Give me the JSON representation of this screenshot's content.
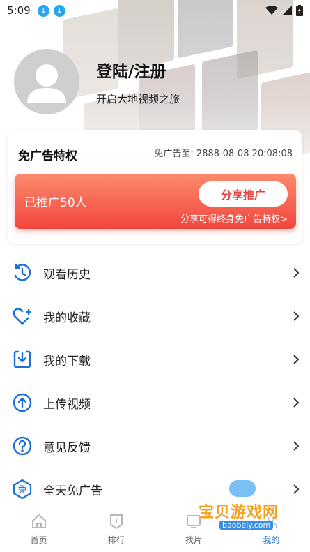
{
  "status_bar": {
    "time": "5:09"
  },
  "profile": {
    "title": "登陆/注册",
    "subtitle": "开启大地视频之旅"
  },
  "vip": {
    "title": "免广告特权",
    "expire_label": "免广告至:",
    "expire_value": "2888-08-08 20:08:08",
    "promo_count": "已推广50人",
    "share_button": "分享推广",
    "promo_note": "分享可得终身免广告特权>"
  },
  "menu": [
    {
      "label": "观看历史",
      "icon": "history-icon"
    },
    {
      "label": "我的收藏",
      "icon": "heart-plus-icon"
    },
    {
      "label": "我的下载",
      "icon": "download-icon"
    },
    {
      "label": "上传视频",
      "icon": "upload-icon"
    },
    {
      "label": "意见反馈",
      "icon": "question-icon"
    },
    {
      "label": "全天免广告",
      "icon": "no-ads-icon",
      "icon_text": "免"
    }
  ],
  "tabs": [
    {
      "label": "首页",
      "icon": "home-icon"
    },
    {
      "label": "排行",
      "icon": "ranking-icon"
    },
    {
      "label": "找片",
      "icon": "search-film-icon"
    },
    {
      "label": "我的",
      "icon": "profile-icon",
      "active": true
    }
  ],
  "watermark": {
    "text": "宝贝游戏网",
    "url": "baobeiy.com"
  },
  "colors": {
    "accent_blue": "#1a6fd8",
    "promo_red": "#f2463f",
    "share_text": "#e8433d"
  }
}
